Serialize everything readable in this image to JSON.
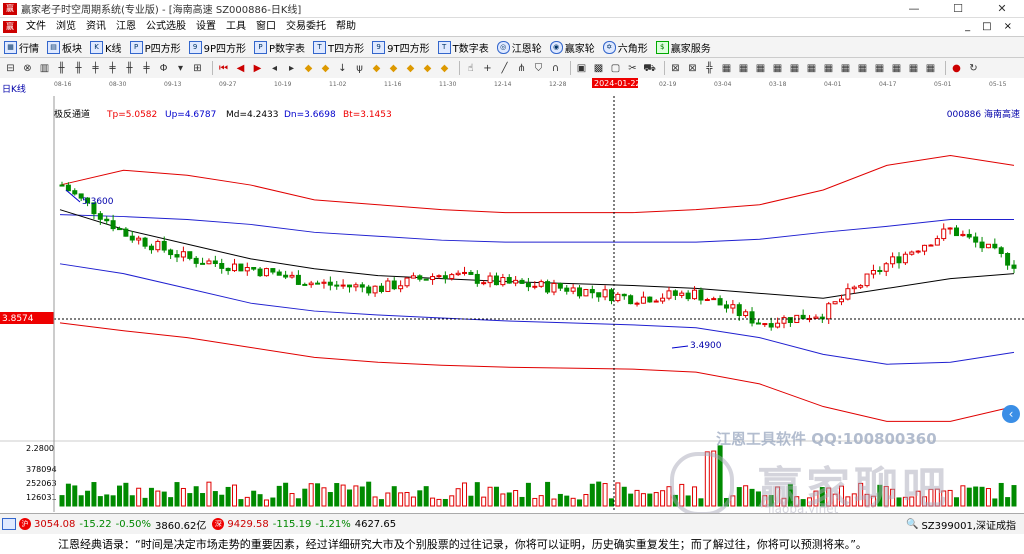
{
  "window": {
    "title": "赢家老子时空周期系统(专业版) - [海南高速  SZ000886-日K线]",
    "min_icon": "minimize-icon",
    "max_icon": "maximize-icon",
    "close_icon": "close-icon"
  },
  "menu": {
    "items": [
      "文件",
      "浏览",
      "资讯",
      "江恩",
      "公式选股",
      "设置",
      "工具",
      "窗口",
      "交易委托",
      "帮助"
    ],
    "right": [
      "_",
      "□",
      "×"
    ]
  },
  "toolbar1": {
    "items": [
      {
        "label": "行情",
        "icon": "grid-icon"
      },
      {
        "label": "板块",
        "icon": "sector-icon"
      },
      {
        "label": "K线",
        "icon": "kline-icon"
      },
      {
        "label": "P四方形",
        "icon": "p-square-icon"
      },
      {
        "label": "9P四方形",
        "icon": "9p-square-icon"
      },
      {
        "label": "P数字表",
        "icon": "p-table-icon"
      },
      {
        "label": "T四方形",
        "icon": "t-square-icon"
      },
      {
        "label": "9T四方形",
        "icon": "9t-square-icon"
      },
      {
        "label": "T数字表",
        "icon": "t-table-icon"
      },
      {
        "label": "江恩轮",
        "icon": "gann-wheel-icon"
      },
      {
        "label": "赢家轮",
        "icon": "winner-wheel-icon"
      },
      {
        "label": "六角形",
        "icon": "hexagon-icon"
      },
      {
        "label": "赢家服务",
        "icon": "dollar-icon"
      }
    ]
  },
  "chart": {
    "period_label": "日K线",
    "indicator_name": "极反通道",
    "tp": "Tp=5.0582",
    "up": "Up=4.6787",
    "md": "Md=4.2433",
    "dn": "Dn=3.6698",
    "bt": "Bt=3.1453",
    "code_name": "000886 海南高速",
    "high_label": "5.3600",
    "low_label": "3.4900",
    "price_cursor": "3.8574",
    "cursor_date": "2024-01-22",
    "date_ticks": [
      "08-16",
      "08-30",
      "09-13",
      "09-27",
      "10-19",
      "11-02",
      "11-16",
      "11-30",
      "12-14",
      "12-28",
      "01-12",
      "02-19",
      "03-04",
      "03-18",
      "04-01",
      "04-17",
      "05-01",
      "05-15"
    ],
    "vol_labels": [
      "2.2800",
      "378094",
      "252063",
      "126031"
    ],
    "colors": {
      "up": "#e00000",
      "down": "#008a00",
      "outer": "#e00000",
      "inner": "#2020d0",
      "mid": "#000000"
    }
  },
  "chart_data": {
    "type": "candlestick",
    "categories": [
      "08-16",
      "08-30",
      "09-13",
      "09-27",
      "10-19",
      "11-02",
      "11-16",
      "11-30",
      "12-14",
      "12-28",
      "01-12",
      "01-22",
      "02-19",
      "03-04",
      "03-18",
      "04-01"
    ],
    "close": [
      5.2,
      4.7,
      4.45,
      4.35,
      4.2,
      4.15,
      4.3,
      4.2,
      4.15,
      4.05,
      4.1,
      3.8,
      3.9,
      4.4,
      4.75,
      4.4
    ],
    "series": [
      {
        "name": "Tp",
        "values": [
          5.2,
          5.35,
          5.3,
          5.2,
          5.05,
          5.0,
          4.95,
          4.92,
          4.92,
          4.92,
          4.95,
          5.0,
          5.15,
          5.4,
          5.5,
          5.4
        ]
      },
      {
        "name": "Up",
        "values": [
          4.9,
          4.88,
          4.85,
          4.8,
          4.72,
          4.68,
          4.64,
          4.62,
          4.62,
          4.62,
          4.62,
          4.65,
          4.72,
          4.78,
          4.85,
          4.85
        ]
      },
      {
        "name": "Md",
        "values": [
          4.95,
          4.75,
          4.6,
          4.45,
          4.35,
          4.28,
          4.25,
          4.22,
          4.2,
          4.18,
          4.15,
          4.1,
          4.05,
          4.15,
          4.25,
          4.3
        ]
      },
      {
        "name": "Dn",
        "values": [
          4.4,
          4.3,
          4.15,
          4.0,
          3.92,
          3.88,
          3.85,
          3.82,
          3.8,
          3.78,
          3.75,
          3.65,
          3.48,
          3.38,
          3.4,
          3.5
        ]
      },
      {
        "name": "Bt",
        "values": [
          3.8,
          3.72,
          3.65,
          3.55,
          3.45,
          3.4,
          3.37,
          3.35,
          3.34,
          3.33,
          3.3,
          3.18,
          2.95,
          2.8,
          2.8,
          2.95
        ]
      }
    ],
    "ylim": [
      2.6,
      5.8
    ]
  },
  "status": {
    "idx1_value": "3054.08",
    "idx1_change": "-15.22",
    "idx1_pct": "-0.50%",
    "idx1_amount": "3860.62亿",
    "idx2_value": "9429.58",
    "idx2_change": "-115.19",
    "idx2_pct": "-1.21%",
    "idx2_amount": "4627.65",
    "right_label": "SZ399001,深证成指"
  },
  "watermark": {
    "line1": "江恩工具软件 QQ:100800360",
    "line2": "赢家聊吧",
    "line3": "liaoba.yjnet"
  },
  "quote": "江恩经典语录：“时间是决定市场走势的重要因素，经过详细研究大市及个别股票的过往记录，你将可以证明，历史确实重复发生；而了解过往，你将可以预测将来。”。"
}
